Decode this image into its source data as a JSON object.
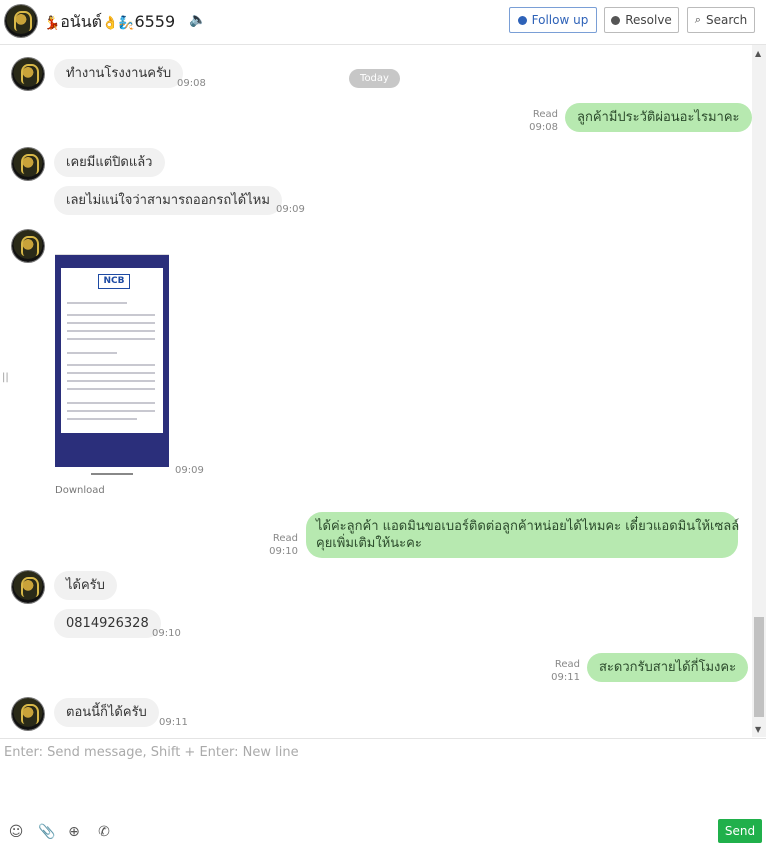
{
  "header": {
    "name_emoji_left": "💃",
    "name": "อนันต์",
    "name_emoji_mid": "👌",
    "name_emoji_right": "🧞",
    "number": "6559",
    "sound_icon": "speaker-icon",
    "buttons": {
      "follow_up": "Follow up",
      "resolve": "Resolve",
      "search": "Search"
    }
  },
  "chat": {
    "today_label": "Today",
    "messages": [
      {
        "dir": "in",
        "text": "ทำงานโรงงานครับ",
        "time": "09:08"
      },
      {
        "dir": "out",
        "text": "ลูกค้ามีประวัติผ่อนอะไรมาคะ",
        "read": "Read",
        "time": "09:08"
      },
      {
        "dir": "in",
        "text": "เคยมีแต่ปิดแล้ว"
      },
      {
        "dir": "in",
        "text": "เลยไม่แน่ใจว่าสามารถออกรถได้ไหม",
        "time": "09:09"
      },
      {
        "dir": "in",
        "type": "image",
        "time": "09:09",
        "download": "Download",
        "image_logo": "NCB"
      },
      {
        "dir": "out",
        "line1": "ได้ค่ะลูกค้า แอดมินขอเบอร์ติดต่อลูกค้าหน่อยได้ไหมคะ เดี๋ยวแอดมินให้เซลล์",
        "line2": "คุยเพิ่มเติมให้นะคะ",
        "read": "Read",
        "time": "09:10"
      },
      {
        "dir": "in",
        "text": "ได้ครับ"
      },
      {
        "dir": "in",
        "text": "0814926328",
        "time": "09:10"
      },
      {
        "dir": "out",
        "text": "สะดวกรับสายได้กี่โมงคะ",
        "read": "Read",
        "time": "09:11"
      },
      {
        "dir": "in",
        "text": "ตอนนี้ก็ได้ครับ",
        "time": "09:11"
      }
    ]
  },
  "composer": {
    "placeholder": "Enter: Send message, Shift + Enter: New line",
    "icons": [
      "emoji-icon",
      "attachment-icon",
      "add-reply-icon",
      "whatsapp-icon"
    ],
    "send_label": "Send"
  },
  "colors": {
    "outgoing_bubble": "#b7e9b0",
    "incoming_bubble": "#f1f1f1",
    "send_button": "#20b04b",
    "follow_up_accent": "#2e62b8"
  }
}
